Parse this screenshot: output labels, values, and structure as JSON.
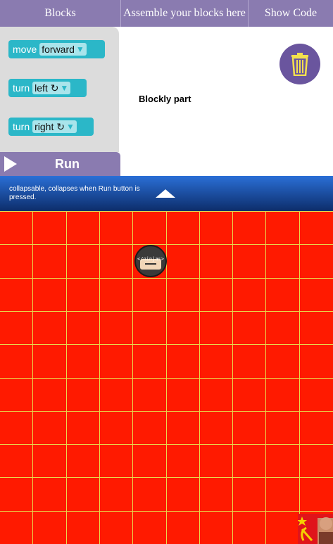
{
  "header": {
    "tab_blocks": "Blocks",
    "tab_assemble": "Assemble your blocks here",
    "tab_show_code": "Show Code"
  },
  "toolbox": {
    "blocks": [
      {
        "keyword": "move",
        "option": "forward"
      },
      {
        "keyword": "turn",
        "option": "left ↻"
      },
      {
        "keyword": "turn",
        "option": "right ↻"
      }
    ]
  },
  "workspace": {
    "label": "Blockly part",
    "trash_icon": "trash-icon"
  },
  "run": {
    "label": "Run"
  },
  "collapse_bar": {
    "text": "collapsable, collapses when Run button is pressed."
  },
  "game": {
    "rows": 10,
    "cols": 10,
    "background": "#ff1a00",
    "grid_line_color": "#e8d84a",
    "ninja_label": "</ninjas>",
    "player_cell": {
      "row": 1,
      "col": 4
    }
  },
  "colors": {
    "header": "#8a7bb0",
    "block": "#2bb7c8",
    "trash": "#6a559e"
  }
}
